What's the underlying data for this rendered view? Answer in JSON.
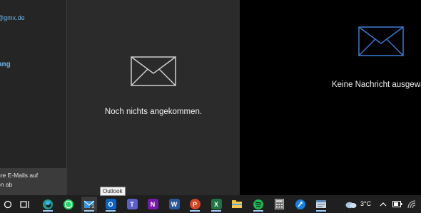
{
  "left_pane": {
    "account_email": "@gmx.de",
    "folder": "ang",
    "promo_line1": "hre E-Mails auf",
    "promo_line2": "on ab"
  },
  "middle_pane": {
    "empty_message": "Noch nichts angekommen."
  },
  "right_pane": {
    "empty_message": "Keine Nachricht ausgewä"
  },
  "tooltip": {
    "text": "Outlook"
  },
  "taskbar": {
    "apps": [
      {
        "name": "search",
        "icon": "search-circle-icon"
      },
      {
        "name": "task-view",
        "icon": "task-view-icon"
      },
      {
        "name": "edge",
        "icon": "edge-icon"
      },
      {
        "name": "whatsapp",
        "icon": "whatsapp-icon"
      },
      {
        "name": "mail",
        "icon": "mail-icon",
        "badge": "1",
        "active": true
      },
      {
        "name": "outlook",
        "icon": "outlook-icon",
        "letter": "O"
      },
      {
        "name": "teams",
        "icon": "teams-icon",
        "letter": "T"
      },
      {
        "name": "onenote",
        "icon": "onenote-icon",
        "letter": "N"
      },
      {
        "name": "word",
        "icon": "word-icon",
        "letter": "W"
      },
      {
        "name": "powerpoint",
        "icon": "powerpoint-icon",
        "letter": "P"
      },
      {
        "name": "excel",
        "icon": "excel-icon",
        "letter": "X"
      },
      {
        "name": "file-explorer",
        "icon": "folder-icon"
      },
      {
        "name": "spotify",
        "icon": "spotify-icon"
      },
      {
        "name": "calculator",
        "icon": "calculator-icon"
      },
      {
        "name": "app-blue",
        "icon": "blue-app-icon"
      },
      {
        "name": "app-window",
        "icon": "window-app-icon"
      }
    ],
    "weather": {
      "icon": "cloud-icon",
      "temperature": "3°C"
    },
    "tray_icons": [
      "chevron-up-icon",
      "battery-icon",
      "network-icon"
    ]
  },
  "colors": {
    "accent": "#6cb4e8",
    "edge": "#1e9e8e",
    "whatsapp": "#25d366",
    "outlook": "#0a64c8",
    "teams": "#5b5fc7",
    "onenote": "#7719aa",
    "word": "#2b579a",
    "powerpoint": "#d24726",
    "excel": "#217346",
    "spotify": "#1db954"
  }
}
